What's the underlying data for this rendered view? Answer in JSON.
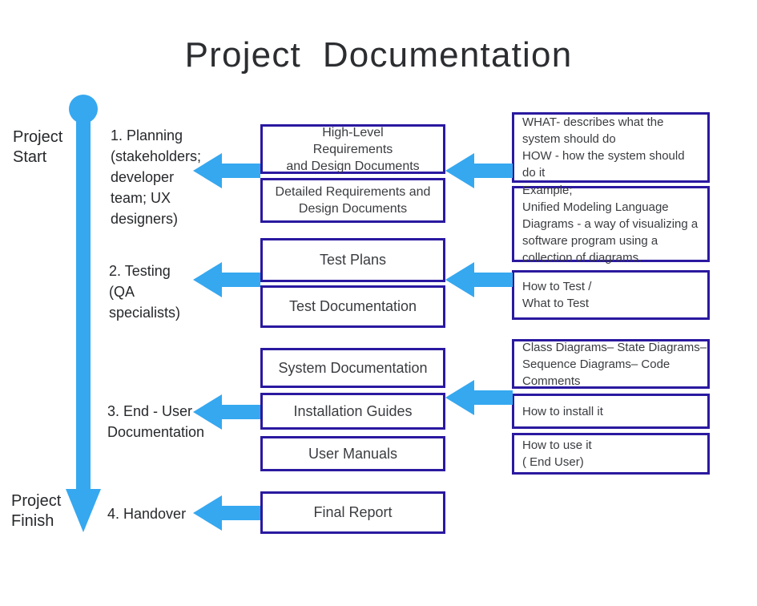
{
  "title": "Project  Documentation",
  "colors": {
    "arrow_blue": "#35a8f0",
    "box_border": "#2a19a0",
    "text": "#3a3c40",
    "background": "#ffffff"
  },
  "timeline": {
    "start_label": "Project\nStart",
    "finish_label": "Project\nFinish",
    "start_marker": "circle",
    "end_marker": "arrowhead-down"
  },
  "stages": [
    {
      "label": "1. Planning\n(stakeholders;\ndeveloper\nteam; UX\ndesigners)"
    },
    {
      "label": "2. Testing\n(QA\nspecialists)"
    },
    {
      "label": "3. End - User\nDocumentation"
    },
    {
      "label": "4. Handover"
    }
  ],
  "documents": [
    {
      "text": "High-Level\nRequirements\nand Design Documents"
    },
    {
      "text": "Detailed Requirements and\nDesign Documents"
    },
    {
      "text": "Test Plans"
    },
    {
      "text": "Test Documentation"
    },
    {
      "text": "System  Documentation"
    },
    {
      "text": "Installation Guides"
    },
    {
      "text": "User Manuals"
    },
    {
      "text": "Final Report"
    }
  ],
  "notes": [
    {
      "text": "WHAT- describes what the\nsystem should do\nHOW - how the system should\ndo it"
    },
    {
      "text": "Example;\nUnified Modeling Language\nDiagrams - a way of visualizing a\nsoftware program using a\ncollection of diagrams."
    },
    {
      "text": "How to Test /\nWhat to Test"
    },
    {
      "text": "Class Diagrams– State Diagrams–\nSequence Diagrams– Code\nComments"
    },
    {
      "text": "How to install it"
    },
    {
      "text": "How to use it\n( End User)"
    }
  ]
}
